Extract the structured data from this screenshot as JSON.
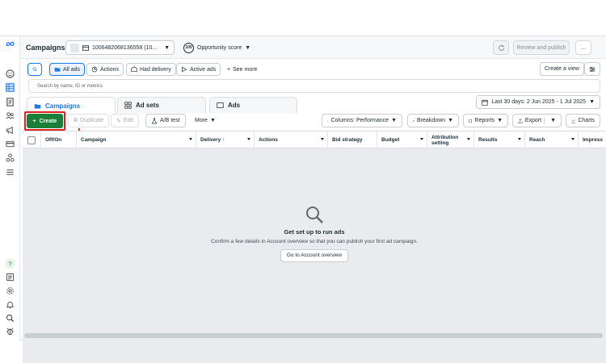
{
  "header": {
    "title": "Campaigns",
    "account": "1006482068136558 (10...",
    "opportunity_score_value": "100",
    "opportunity_score_label": "Opportunity score",
    "review_publish": "Review and publish",
    "more": "..."
  },
  "toolbar": {
    "all_ads": "All ads",
    "actions": "Actions",
    "had_delivery": "Had delivery",
    "active_ads": "Active ads",
    "see_more": "See more",
    "create_view": "Create a view"
  },
  "search": {
    "placeholder": "Search by name, ID or metrics"
  },
  "tabs": [
    {
      "label": "Campaigns"
    },
    {
      "label": "Ad sets"
    },
    {
      "label": "Ads"
    }
  ],
  "date_range": "Last 30 days: 2 Jun 2025 - 1 Jul 2025",
  "actions_row": {
    "create": "Create",
    "duplicate": "Duplicate",
    "edit": "Edit",
    "ab_test": "A/B test",
    "more": "More",
    "columns": "Columns: Performance",
    "breakdown": "Breakdown",
    "reports": "Reports",
    "export": "Export",
    "charts": "Charts"
  },
  "table": {
    "columns": [
      "Off/On",
      "Campaign",
      "Delivery ↑",
      "Actions",
      "Bid strategy",
      "Budget",
      "Attribution setting",
      "Results",
      "Reach",
      "Impress"
    ]
  },
  "empty_state": {
    "title": "Get set up to run ads",
    "message": "Confirm a few details in Account overview so that you can publish your first ad campaign.",
    "button": "Go to Account overview"
  },
  "colors": {
    "brand": "#1877f2",
    "create_green": "#1a7f37",
    "highlight_red": "#e02020"
  }
}
